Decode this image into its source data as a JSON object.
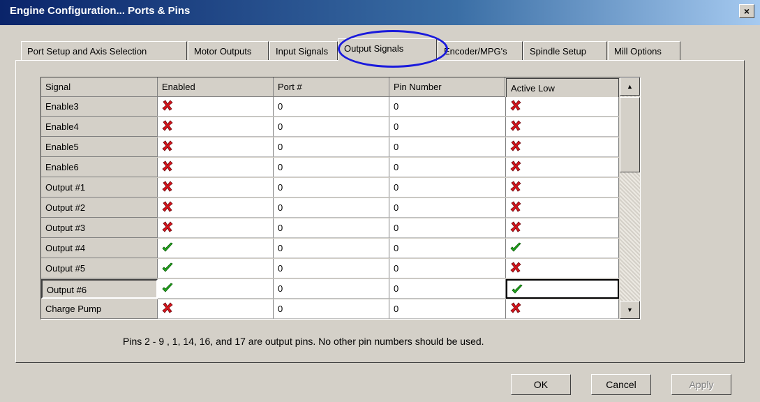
{
  "window": {
    "title": "Engine Configuration... Ports & Pins",
    "close_label": "×"
  },
  "tabs": [
    {
      "label": "Port Setup and Axis Selection"
    },
    {
      "label": "Motor Outputs"
    },
    {
      "label": "Input Signals"
    },
    {
      "label": "Output Signals"
    },
    {
      "label": "Encoder/MPG's"
    },
    {
      "label": "Spindle Setup"
    },
    {
      "label": "Mill Options"
    }
  ],
  "active_tab": "Output Signals",
  "grid": {
    "columns": [
      "Signal",
      "Enabled",
      "Port #",
      "Pin Number",
      "Active Low"
    ],
    "rows": [
      {
        "signal": "Enable3",
        "enabled": false,
        "port": "0",
        "pin": "0",
        "active_low": false
      },
      {
        "signal": "Enable4",
        "enabled": false,
        "port": "0",
        "pin": "0",
        "active_low": false
      },
      {
        "signal": "Enable5",
        "enabled": false,
        "port": "0",
        "pin": "0",
        "active_low": false
      },
      {
        "signal": "Enable6",
        "enabled": false,
        "port": "0",
        "pin": "0",
        "active_low": false
      },
      {
        "signal": "Output #1",
        "enabled": false,
        "port": "0",
        "pin": "0",
        "active_low": false
      },
      {
        "signal": "Output #2",
        "enabled": false,
        "port": "0",
        "pin": "0",
        "active_low": false
      },
      {
        "signal": "Output #3",
        "enabled": false,
        "port": "0",
        "pin": "0",
        "active_low": false
      },
      {
        "signal": "Output #4",
        "enabled": true,
        "port": "0",
        "pin": "0",
        "active_low": true
      },
      {
        "signal": "Output #5",
        "enabled": true,
        "port": "0",
        "pin": "0",
        "active_low": false
      },
      {
        "signal": "Output #6",
        "enabled": true,
        "port": "0",
        "pin": "0",
        "active_low": true
      },
      {
        "signal": "Charge Pump",
        "enabled": false,
        "port": "0",
        "pin": "0",
        "active_low": false
      }
    ]
  },
  "note": "Pins 2 - 9 , 1, 14, 16, and 17 are output pins. No  other pin numbers should be used.",
  "buttons": {
    "ok": "OK",
    "cancel": "Cancel",
    "apply": "Apply"
  },
  "icons": {
    "enabled_true": "check-icon",
    "enabled_false": "x-icon"
  },
  "colors": {
    "check": "#22a61c",
    "x": "#d8141c",
    "highlight_ellipse": "#1a1adc"
  }
}
